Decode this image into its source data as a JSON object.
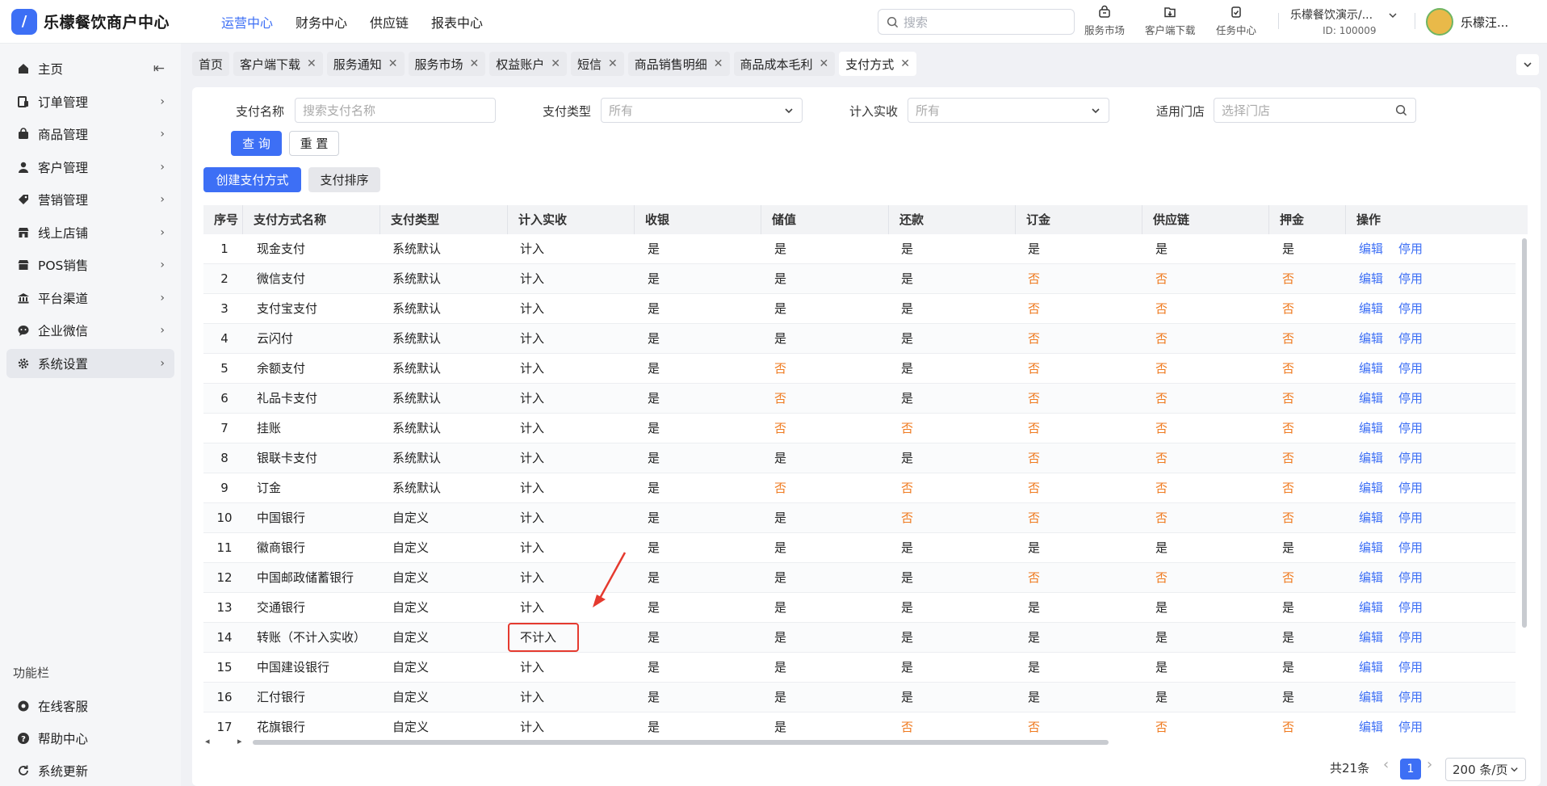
{
  "app": {
    "brand": "乐檬餐饮商户中心",
    "logo_glyph": "/"
  },
  "topnav": [
    "运营中心",
    "财务中心",
    "供应链",
    "报表中心"
  ],
  "search": {
    "placeholder": "搜索"
  },
  "tools": [
    {
      "label": "服务市场",
      "icon": "shop-bag-icon"
    },
    {
      "label": "客户端下载",
      "icon": "download-icon"
    },
    {
      "label": "任务中心",
      "icon": "task-clipboard-icon"
    }
  ],
  "tenant": {
    "name": "乐檬餐饮演示/...",
    "id": "ID: 100009"
  },
  "user": {
    "name": "乐檬汪..."
  },
  "sidebar": {
    "items": [
      {
        "label": "主页",
        "icon": "home-icon",
        "collapse": "⇤"
      },
      {
        "label": "订单管理",
        "icon": "order-icon"
      },
      {
        "label": "商品管理",
        "icon": "goods-bag-icon"
      },
      {
        "label": "客户管理",
        "icon": "customer-icon"
      },
      {
        "label": "营销管理",
        "icon": "tag-icon"
      },
      {
        "label": "线上店铺",
        "icon": "store-icon"
      },
      {
        "label": "POS销售",
        "icon": "pos-icon"
      },
      {
        "label": "平台渠道",
        "icon": "bank-icon"
      },
      {
        "label": "企业微信",
        "icon": "wechat-icon"
      },
      {
        "label": "系统设置",
        "icon": "gear-icon"
      }
    ],
    "section": "功能栏",
    "footer": [
      {
        "label": "在线客服",
        "icon": "service-icon"
      },
      {
        "label": "帮助中心",
        "icon": "help-icon"
      },
      {
        "label": "系统更新",
        "icon": "refresh-icon"
      }
    ]
  },
  "tabs": [
    "首页",
    "客户端下载",
    "服务通知",
    "服务市场",
    "权益账户",
    "短信",
    "商品销售明细",
    "商品成本毛利",
    "支付方式"
  ],
  "filters": {
    "name_label": "支付名称",
    "name_placeholder": "搜索支付名称",
    "type_label": "支付类型",
    "type_value": "所有",
    "count_label": "计入实收",
    "count_value": "所有",
    "store_label": "适用门店",
    "store_placeholder": "选择门店",
    "query": "查 询",
    "reset": "重 置"
  },
  "actions": {
    "create": "创建支付方式",
    "sort": "支付排序"
  },
  "table": {
    "headers": [
      "序号",
      "支付方式名称",
      "支付类型",
      "计入实收",
      "收银",
      "储值",
      "还款",
      "订金",
      "供应链",
      "押金",
      "操作"
    ],
    "edit": "编辑",
    "disable": "停用",
    "rows": [
      [
        "1",
        "现金支付",
        "系统默认",
        "计入",
        "是",
        "是",
        "是",
        "是",
        "是",
        "是"
      ],
      [
        "2",
        "微信支付",
        "系统默认",
        "计入",
        "是",
        "是",
        "是",
        "否",
        "否",
        "否"
      ],
      [
        "3",
        "支付宝支付",
        "系统默认",
        "计入",
        "是",
        "是",
        "是",
        "否",
        "否",
        "否"
      ],
      [
        "4",
        "云闪付",
        "系统默认",
        "计入",
        "是",
        "是",
        "是",
        "否",
        "否",
        "否"
      ],
      [
        "5",
        "余额支付",
        "系统默认",
        "计入",
        "是",
        "否",
        "是",
        "否",
        "否",
        "否"
      ],
      [
        "6",
        "礼品卡支付",
        "系统默认",
        "计入",
        "是",
        "否",
        "是",
        "否",
        "否",
        "否"
      ],
      [
        "7",
        "挂账",
        "系统默认",
        "计入",
        "是",
        "否",
        "否",
        "否",
        "否",
        "否"
      ],
      [
        "8",
        "银联卡支付",
        "系统默认",
        "计入",
        "是",
        "是",
        "是",
        "否",
        "否",
        "否"
      ],
      [
        "9",
        "订金",
        "系统默认",
        "计入",
        "是",
        "否",
        "否",
        "否",
        "否",
        "否"
      ],
      [
        "10",
        "中国银行",
        "自定义",
        "计入",
        "是",
        "是",
        "否",
        "否",
        "否",
        "否"
      ],
      [
        "11",
        "徽商银行",
        "自定义",
        "计入",
        "是",
        "是",
        "是",
        "是",
        "是",
        "是"
      ],
      [
        "12",
        "中国邮政储蓄银行",
        "自定义",
        "计入",
        "是",
        "是",
        "是",
        "否",
        "否",
        "否"
      ],
      [
        "13",
        "交通银行",
        "自定义",
        "计入",
        "是",
        "是",
        "是",
        "是",
        "是",
        "是"
      ],
      [
        "14",
        "转账（不计入实收）",
        "自定义",
        "不计入",
        "是",
        "是",
        "是",
        "是",
        "是",
        "是"
      ],
      [
        "15",
        "中国建设银行",
        "自定义",
        "计入",
        "是",
        "是",
        "是",
        "是",
        "是",
        "是"
      ],
      [
        "16",
        "汇付银行",
        "自定义",
        "计入",
        "是",
        "是",
        "是",
        "是",
        "是",
        "是"
      ],
      [
        "17",
        "花旗银行",
        "自定义",
        "计入",
        "是",
        "是",
        "否",
        "否",
        "否",
        "否"
      ]
    ]
  },
  "pagination": {
    "total": "共21条",
    "prev": "‹",
    "page": "1",
    "next": "›",
    "size": "200 条/页"
  },
  "colors": {
    "accent": "#3d6ff5",
    "negative": "#ef7a1f",
    "highlight": "#e53a2f"
  }
}
